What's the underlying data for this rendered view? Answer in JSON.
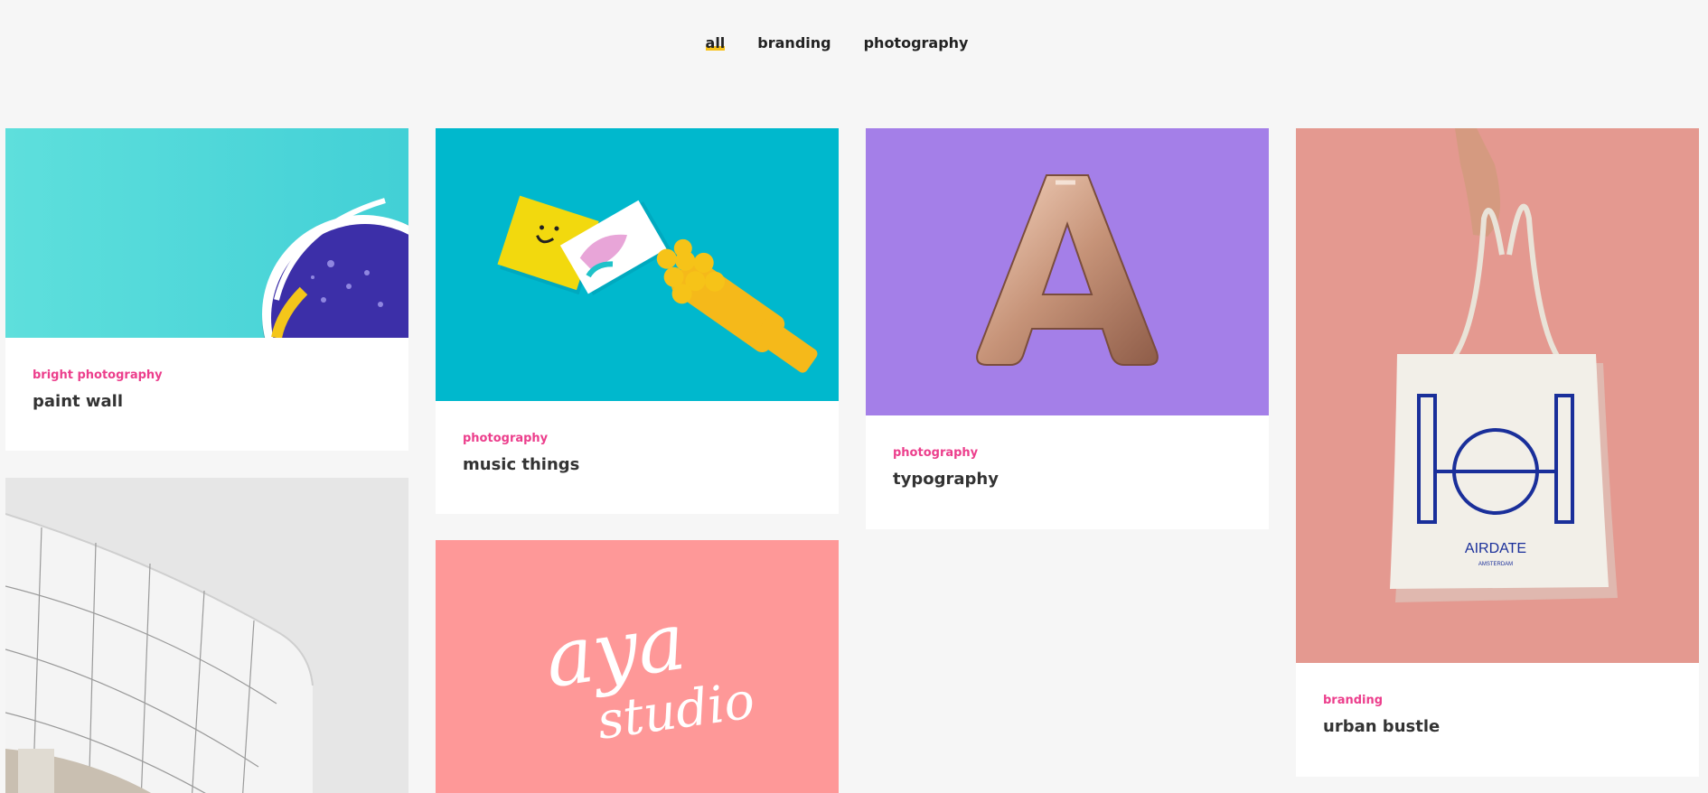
{
  "filters": [
    {
      "label": "all",
      "active": true
    },
    {
      "label": "branding",
      "active": false
    },
    {
      "label": "photography",
      "active": false
    }
  ],
  "portfolio": [
    {
      "category": "bright photography",
      "title": "paint wall",
      "image": "blue-ball-on-teal"
    },
    {
      "category": "photography",
      "title": "music things",
      "image": "business-cards-and-paintbrush"
    },
    {
      "category": "photography",
      "title": "typography",
      "image": "rose-gold-letter-balloon"
    },
    {
      "category": "branding",
      "title": "urban bustle",
      "image": "tote-bag-on-pink"
    },
    {
      "image": "white-building-facade"
    },
    {
      "image": "script-logo-on-pink",
      "logo_text_line1": "aya",
      "logo_text_line2": "studio"
    }
  ],
  "tote_print": {
    "brand": "AIRDATE",
    "city": "AMSTERDAM"
  },
  "balloon_letter": "A",
  "colors": {
    "accent_pink": "#ec3e8c",
    "active_underline": "#f7c21b",
    "background": "#f6f6f6"
  }
}
